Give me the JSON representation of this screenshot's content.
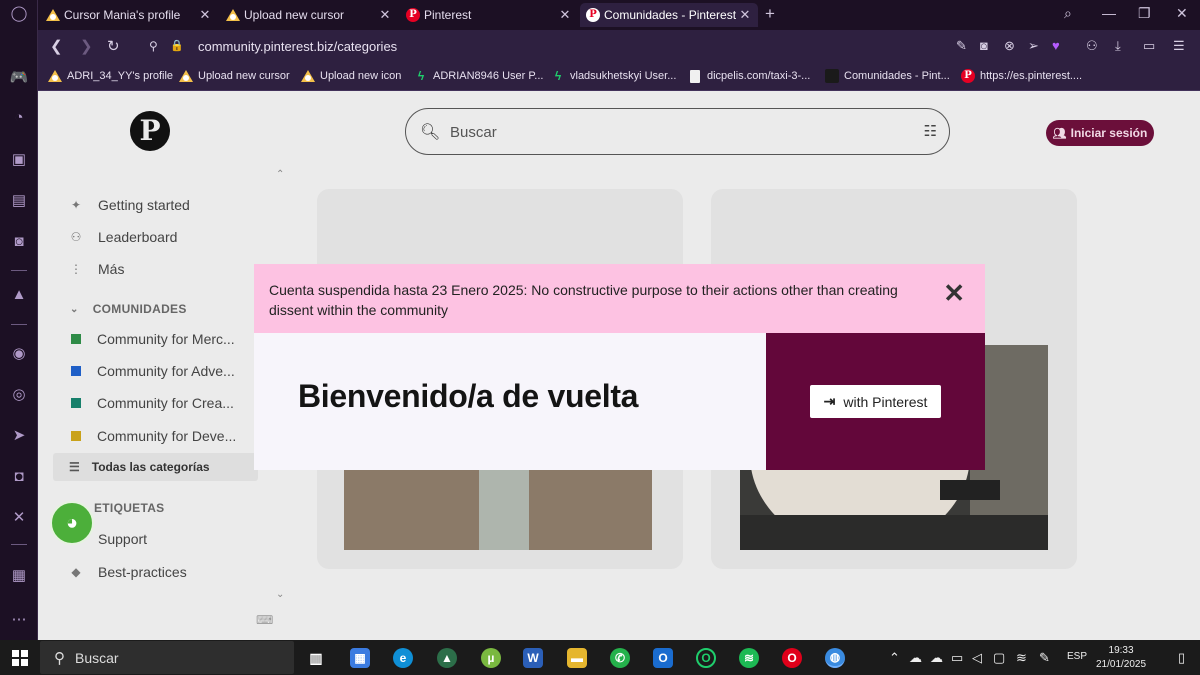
{
  "tabs": [
    {
      "title": "Cursor Mania's profile",
      "close": "✕",
      "favicon": "triangle-logo-icon"
    },
    {
      "title": "Upload new cursor",
      "close": "✕",
      "favicon": "triangle-logo-icon"
    },
    {
      "title": "Pinterest",
      "close": "✕",
      "favicon": "pinterest-icon"
    },
    {
      "title": "Comunidades - Pinterest Community",
      "close": "✕",
      "favicon": "pinterest-icon",
      "active": true
    }
  ],
  "address_bar": {
    "url": "community.pinterest.biz/categories"
  },
  "bookmarks": [
    {
      "label": "ADRI_34_YY's profile",
      "icon": "triangle-logo-icon"
    },
    {
      "label": "Upload new cursor",
      "icon": "triangle-logo-icon"
    },
    {
      "label": "Upload new icon",
      "icon": "triangle-logo-icon"
    },
    {
      "label": "ADRIAN8946 User P...",
      "icon": "bolt-icon"
    },
    {
      "label": "vladsukhetskyi User...",
      "icon": "bolt-icon"
    },
    {
      "label": "dicpelis.com/taxi-3-...",
      "icon": "document-icon"
    },
    {
      "label": "Comunidades - Pint...",
      "icon": "dark-square-icon"
    },
    {
      "label": "https://es.pinterest....",
      "icon": "pinterest-icon"
    }
  ],
  "header": {
    "search_placeholder": "Buscar",
    "login_label": "Iniciar sesión"
  },
  "sidebar_nav": {
    "top_items": [
      "Getting started",
      "Leaderboard",
      "Más"
    ],
    "communities_heading": "COMUNIDADES",
    "communities": [
      {
        "label": "Community for Merc...",
        "color": "#2e8b47"
      },
      {
        "label": "Community for Adve...",
        "color": "#1f5fc7"
      },
      {
        "label": "Community for Crea...",
        "color": "#17806b"
      },
      {
        "label": "Community for Deve...",
        "color": "#c9a21a"
      }
    ],
    "all_categories": "Todas las categorías",
    "tags_heading": "ETIQUETAS",
    "tags": [
      "Support",
      "Best-practices"
    ]
  },
  "modal": {
    "alert": "Cuenta suspendida hasta 23 Enero 2025: No constructive purpose to their actions other than creating dissent within the community",
    "close_glyph": "✕",
    "welcome": "Bienvenido/a de vuelta",
    "login_with": "with Pinterest",
    "brand_color": "#63073a",
    "alert_color": "#fdc2e2"
  },
  "taskbar": {
    "search_label": "Buscar",
    "language": "ESP",
    "time": "19:33",
    "date": "21/01/2025"
  }
}
